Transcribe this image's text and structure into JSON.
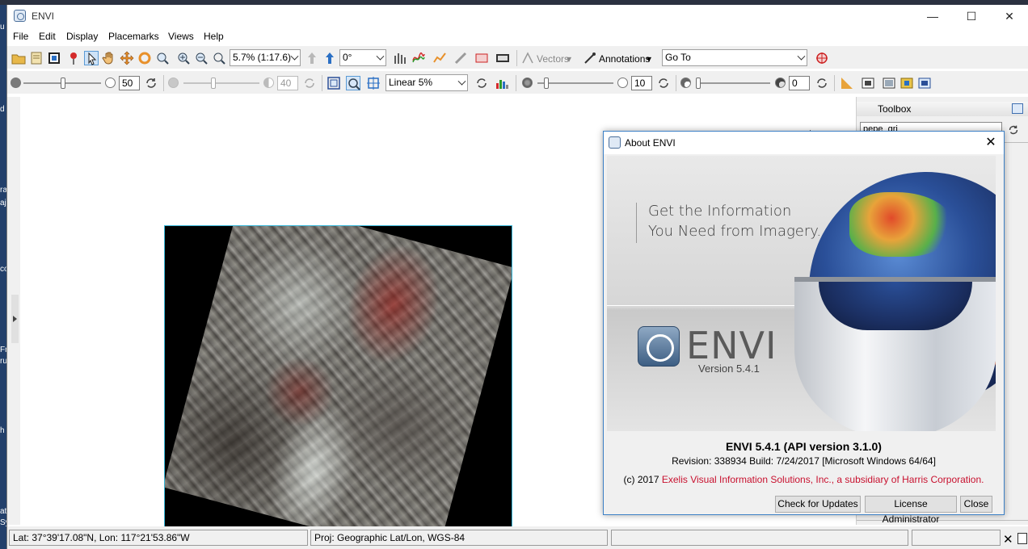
{
  "window": {
    "title": "ENVI"
  },
  "menu": [
    "File",
    "Edit",
    "Display",
    "Placemarks",
    "Views",
    "Help"
  ],
  "toolbar": {
    "zoom_value": "5.7% (1:17.6)",
    "rotation_value": "0°",
    "vectors_label": "Vectors",
    "annotations_label": "Annotations",
    "goto_value": "Go To"
  },
  "toolbar2": {
    "brightness_value": "50",
    "contrast_value": "40",
    "stretch_value": "Linear 5%",
    "sharpen_value": "10",
    "transparency_value": "0"
  },
  "toolbox": {
    "title": "Toolbox",
    "search_value": "pepe_gri"
  },
  "statusbar": {
    "coords": "Lat: 37°39'17.08\"N, Lon: 117°21'53.86\"W",
    "projection": "Proj: Geographic Lat/Lon, WGS-84"
  },
  "about": {
    "title": "About ENVI",
    "tagline_1": "Get the Information",
    "tagline_2": "You Need from Imagery.",
    "logo_word": "ENVI",
    "version_label": "Version 5.4.1",
    "main_line": "ENVI 5.4.1  (API version 3.1.0)",
    "revision_line": "Revision: 338934  Build: 7/24/2017  [Microsoft Windows 64/64]",
    "copyright_prefix": "(c) 2017 ",
    "licensee": "Exelis Visual Information Solutions, Inc., a subsidiary of Harris Corporation.",
    "buttons": [
      "Check for Updates",
      "License Administrator",
      "Close"
    ]
  },
  "desktop_fragments": [
    "u",
    "d",
    "ra",
    "aj",
    "co",
    "Fr",
    "ru",
    "h",
    "at",
    "Sy"
  ]
}
